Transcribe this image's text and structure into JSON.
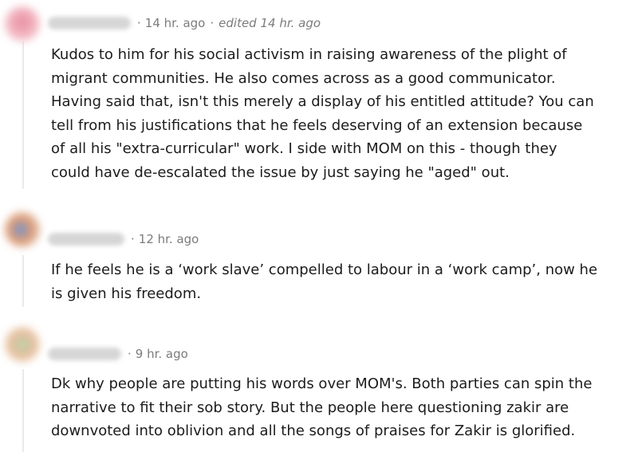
{
  "comments": [
    {
      "avatar_color": "#e57a8e",
      "timestamp": "14 hr. ago",
      "edited": "edited 14 hr. ago",
      "body_lines": [
        "Kudos to him for his social activism in raising awareness of the plight of",
        "migrant communities. He also comes across as a good communicator.",
        "Having said that, isn't this merely a display of his entitled attitude? You can",
        "tell from his justifications that he feels deserving of an extension because",
        "of all his \"extra-curricular\" work. I side with MOM on this - though they",
        "could have de-escalated the issue by just saying he \"aged\" out."
      ]
    },
    {
      "avatar_color": "#5a8fd8",
      "timestamp": "12 hr. ago",
      "body_lines": [
        "If he feels he is a ‘work slave’ compelled to labour in a ‘work camp’, now he",
        "is given his freedom."
      ]
    },
    {
      "avatar_color": "#9fc79a",
      "timestamp": "9 hr. ago",
      "body_lines": [
        "Dk why people are putting his words over MOM's. Both parties can spin the",
        "narrative to fit their sob story. But the people here questioning zakir are",
        "downvoted into oblivion and all the songs of praises for Zakir is glorified."
      ]
    }
  ]
}
